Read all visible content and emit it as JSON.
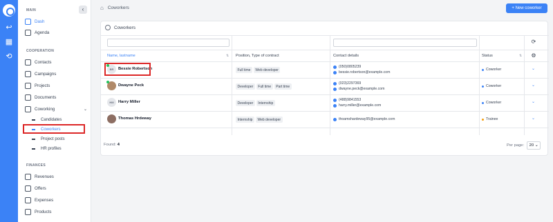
{
  "sidebar": {
    "main_label": "MAIN",
    "main_items": [
      {
        "label": "Dash",
        "icon": "dashboard-icon"
      },
      {
        "label": "Agenda",
        "icon": "calendar-icon"
      }
    ],
    "cooperation_label": "COOPERATION",
    "cooperation_items": [
      {
        "label": "Contacts",
        "icon": "contacts-icon"
      },
      {
        "label": "Campaigns",
        "icon": "megaphone-icon"
      },
      {
        "label": "Projects",
        "icon": "projects-icon"
      },
      {
        "label": "Documents",
        "icon": "document-icon"
      },
      {
        "label": "Coworking",
        "icon": "coworking-icon"
      }
    ],
    "coworking_sub": [
      "Candidates",
      "Coworkers",
      "Project posts",
      "HR profiles"
    ],
    "finances_label": "FINANCES",
    "finance_items": [
      {
        "label": "Revenues",
        "icon": "revenue-icon"
      },
      {
        "label": "Offers",
        "icon": "offers-icon"
      },
      {
        "label": "Expenses",
        "icon": "expenses-icon"
      },
      {
        "label": "Products",
        "icon": "products-icon"
      }
    ]
  },
  "header": {
    "breadcrumb": "Coworkers",
    "new_button": "+ New coworker"
  },
  "card": {
    "title": "Coworkers",
    "columns": [
      "Name, lastname",
      "Position, Type of contract",
      "Contact details",
      "Status"
    ],
    "rows": [
      {
        "initials": "BR",
        "name": "Bessie Robertson",
        "tags": [
          "Full time",
          "Web developer"
        ],
        "phone": "(050)0805239",
        "email": "bessie.robertson@example.com",
        "status": "Coworker",
        "status_color": "#3b82f6",
        "photo": false,
        "online": true
      },
      {
        "initials": "",
        "name": "Dwayne Peck",
        "tags": [
          "Developer",
          "Full time",
          "Part time"
        ],
        "phone": "(023)2297369",
        "email": "dwayne.peck@example.com",
        "status": "Coworker",
        "status_color": "#3b82f6",
        "photo": true,
        "online": true
      },
      {
        "initials": "HM",
        "name": "Harry Miller",
        "tags": [
          "Developer",
          "Internship"
        ],
        "phone": "(488)9841553",
        "email": "harry.miller@example.com",
        "status": "Coworker",
        "status_color": "#3b82f6",
        "photo": false,
        "online": false
      },
      {
        "initials": "",
        "name": "Thomas Hrdeway",
        "tags": [
          "Internship",
          "Web developer"
        ],
        "phone": "",
        "email": "thoamshardeway95@example.com",
        "status": "Trainee",
        "status_color": "#f59e0b",
        "photo": true,
        "online": false
      }
    ],
    "found_label": "Found:",
    "found_count": "4",
    "per_page_label": "Per page:",
    "per_page_value": "20"
  }
}
